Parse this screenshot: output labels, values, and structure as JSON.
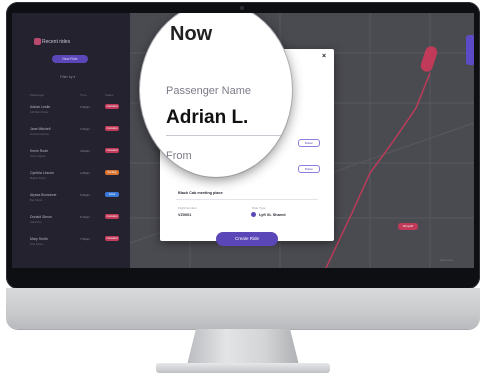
{
  "sidebar": {
    "brand": "Recent rides",
    "new_ride": "New Ride",
    "filter": "Filter by ▾",
    "col_passenger": "Passenger",
    "col_time": "Time",
    "col_status": "Status",
    "rides": [
      {
        "name": "Adrian Leslie",
        "sub": "123 Main Street",
        "time": "2:30pm",
        "status": "Cancelled",
        "color": "#c23a5a"
      },
      {
        "name": "Jane Mitchell",
        "sub": "Fremont Avenue",
        "time": "3:15pm",
        "status": "Cancelled",
        "color": "#c23a5a"
      },
      {
        "name": "Kevin Rode",
        "sub": "Union Square",
        "time": "4:00pm",
        "status": "Cancelled",
        "color": "#c23a5a"
      },
      {
        "name": "Cynthia Lincoln",
        "sub": "Market Street",
        "time": "4:45pm",
        "status": "Pending",
        "color": "#d8722f"
      },
      {
        "name": "Alyssa Brundone",
        "sub": "Bay Street",
        "time": "5:20pm",
        "status": "Active",
        "color": "#3a79d8"
      },
      {
        "name": "Donald Simon",
        "sub": "Oak Drive",
        "time": "6:10pm",
        "status": "Cancelled",
        "color": "#c23a5a"
      },
      {
        "name": "Mary Smith",
        "sub": "Pine Street",
        "time": "7:00pm",
        "status": "Cancelled",
        "color": "#c23a5a"
      }
    ]
  },
  "map": {
    "label": "Dropoff",
    "credit": "Map data"
  },
  "modal": {
    "close": "×",
    "tag1": "Button",
    "tag2": "Button",
    "address_value": "Black Cab meeting place",
    "flight_label": "Flight Number",
    "flight_value": "VZ0001",
    "ride_type_label": "Ride Type",
    "ride_type_value": "Lyft XL Shared",
    "create_ride": "Create Ride"
  },
  "magnifier": {
    "now": "Now",
    "passenger_label": "Passenger Name",
    "passenger_value": "Adrian L.",
    "from_label": "From"
  }
}
